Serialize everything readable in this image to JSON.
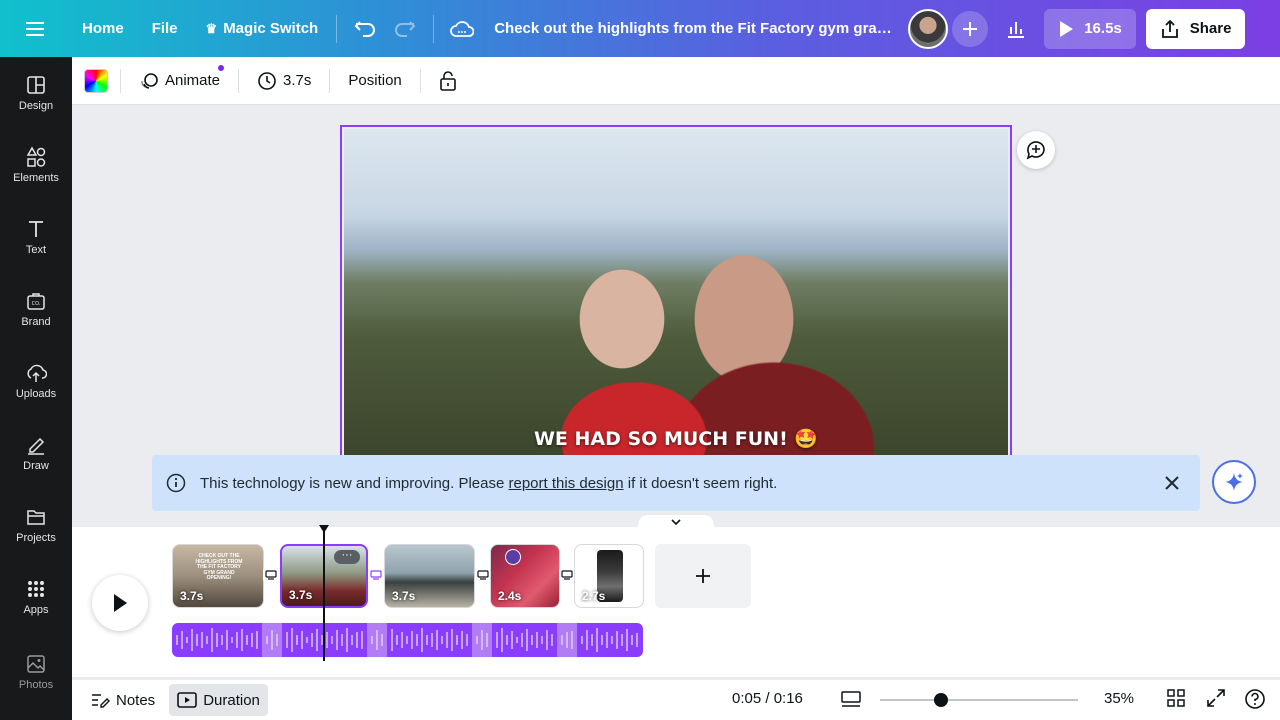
{
  "topbar": {
    "home": "Home",
    "file": "File",
    "magic_switch": "Magic Switch",
    "title": "Check out the highlights from the Fit Factory gym grand ...",
    "play_duration": "16.5s",
    "share": "Share"
  },
  "sidebar": {
    "items": [
      {
        "label": "Design",
        "icon": "design-icon"
      },
      {
        "label": "Elements",
        "icon": "elements-icon"
      },
      {
        "label": "Text",
        "icon": "text-icon"
      },
      {
        "label": "Brand",
        "icon": "brand-icon"
      },
      {
        "label": "Uploads",
        "icon": "uploads-icon"
      },
      {
        "label": "Draw",
        "icon": "draw-icon"
      },
      {
        "label": "Projects",
        "icon": "projects-icon"
      },
      {
        "label": "Apps",
        "icon": "apps-icon"
      }
    ],
    "photos": "Photos"
  },
  "toolbar": {
    "animate": "Animate",
    "duration": "3.7s",
    "position": "Position"
  },
  "canvas": {
    "caption": "WE HAD SO MUCH FUN! 🤩"
  },
  "notice": {
    "text_before": "This technology is new and improving. Please ",
    "link": "report this design",
    "text_after": " if it doesn't seem right."
  },
  "timeline": {
    "clips": [
      {
        "duration": "3.7s",
        "overlay": "CHECK OUT THE HIGHLIGHTS FROM THE FIT FACTORY GYM GRAND OPENING!"
      },
      {
        "duration": "3.7s",
        "selected": true
      },
      {
        "duration": "3.7s"
      },
      {
        "duration": "2.4s"
      },
      {
        "duration": "2.7s"
      }
    ]
  },
  "footer": {
    "notes": "Notes",
    "duration": "Duration",
    "time": "0:05 / 0:16",
    "zoom_percent": "35%",
    "zoom_level": 0.31
  },
  "colors": {
    "accent": "#8b3dff",
    "notice_bg": "#cfe2fb",
    "sidebar_bg": "#18191b"
  }
}
